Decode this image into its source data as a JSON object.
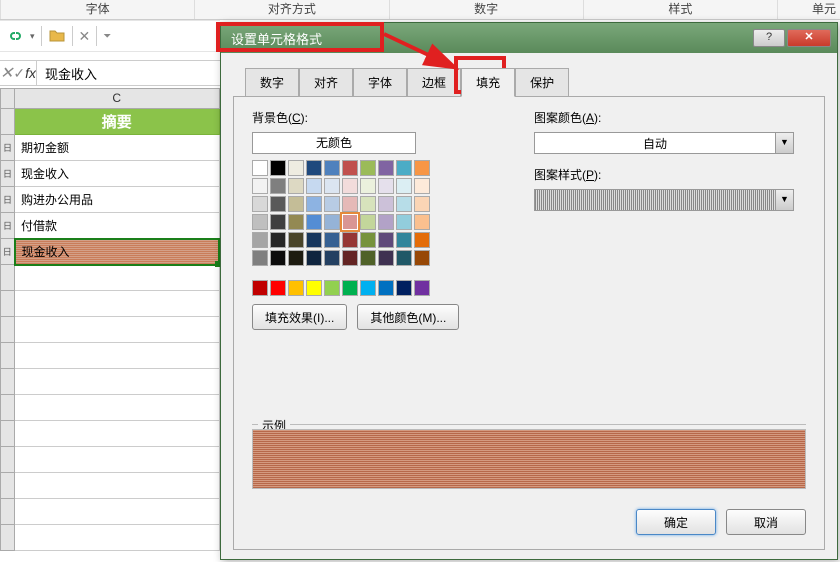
{
  "ribbon": {
    "labels": [
      "字体",
      "对齐方式",
      "数字",
      "样式",
      "单元"
    ]
  },
  "formula": {
    "value": "现金收入",
    "fx": "fx"
  },
  "sheet": {
    "col": "C",
    "header": "摘要",
    "rows": [
      "期初金额",
      "现金收入",
      "购进办公用品",
      "付借款",
      "现金收入",
      "",
      "",
      "",
      "",
      "",
      "",
      "",
      "",
      "",
      "",
      "",
      ""
    ],
    "selected_index": 4
  },
  "dialog": {
    "title": "设置单元格格式",
    "tabs": [
      "数字",
      "对齐",
      "字体",
      "边框",
      "填充",
      "保护"
    ],
    "active_tab": 4,
    "bg_label_pre": "背景色(",
    "bg_label_u": "C",
    "bg_label_post": "):",
    "no_color": "无颜色",
    "fill_effects": "填充效果(I)...",
    "other_colors": "其他颜色(M)...",
    "pattern_color_pre": "图案颜色(",
    "pattern_color_u": "A",
    "pattern_color_post": "):",
    "auto": "自动",
    "pattern_style_pre": "图案样式(",
    "pattern_style_u": "P",
    "pattern_style_post": "):",
    "example": "示例",
    "ok": "确定",
    "cancel": "取消"
  },
  "palette_theme": [
    [
      "#ffffff",
      "#000000",
      "#eeece1",
      "#1f497d",
      "#4f81bd",
      "#c0504d",
      "#9bbb59",
      "#8064a2",
      "#4bacc6",
      "#f79646"
    ],
    [
      "#f2f2f2",
      "#7f7f7f",
      "#ddd9c3",
      "#c6d9f0",
      "#dbe5f1",
      "#f2dcdb",
      "#ebf1dd",
      "#e5e0ec",
      "#dbeef3",
      "#fdeada"
    ],
    [
      "#d8d8d8",
      "#595959",
      "#c4bd97",
      "#8db3e2",
      "#b8cce4",
      "#e5b9b7",
      "#d7e3bc",
      "#ccc1d9",
      "#b7dde8",
      "#fbd5b5"
    ],
    [
      "#bfbfbf",
      "#3f3f3f",
      "#938953",
      "#548dd4",
      "#95b3d7",
      "#d99694",
      "#c3d69b",
      "#b2a2c7",
      "#92cddc",
      "#fac08f"
    ],
    [
      "#a5a5a5",
      "#262626",
      "#494429",
      "#17365d",
      "#366092",
      "#953734",
      "#76923c",
      "#5f497a",
      "#31859b",
      "#e36c09"
    ],
    [
      "#7f7f7f",
      "#0c0c0c",
      "#1d1b10",
      "#0f243e",
      "#244061",
      "#632423",
      "#4f6128",
      "#3f3151",
      "#205867",
      "#974806"
    ]
  ],
  "palette_std": [
    "#c00000",
    "#ff0000",
    "#ffc000",
    "#ffff00",
    "#92d050",
    "#00b050",
    "#00b0f0",
    "#0070c0",
    "#002060",
    "#7030a0"
  ],
  "selected_swatch": {
    "row": 3,
    "col": 5
  }
}
